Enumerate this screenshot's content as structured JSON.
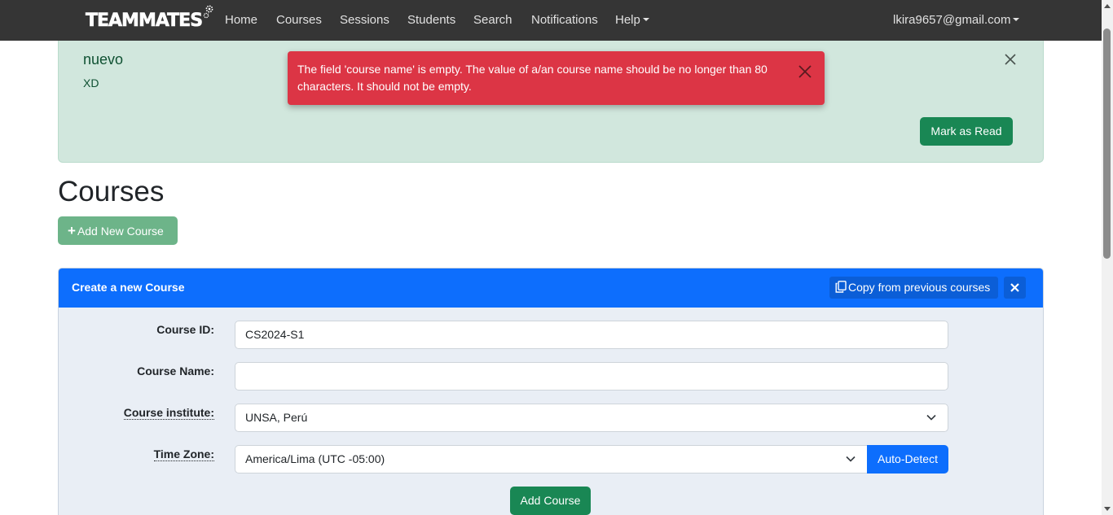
{
  "navbar": {
    "brand": "TEAMMATES",
    "items": [
      "Home",
      "Courses",
      "Sessions",
      "Students",
      "Search",
      "Notifications",
      "Help"
    ],
    "user": "lkira9657@gmail.com"
  },
  "notification": {
    "title": "nuevo",
    "body": "XD",
    "mark_read_label": "Mark as Read"
  },
  "error_toast": {
    "message": "The field 'course name' is empty. The value of a/an course name should be no longer than 80 characters. It should not be empty."
  },
  "page": {
    "title": "Courses",
    "add_new_course_label": "Add New Course"
  },
  "create_course": {
    "title": "Create a new Course",
    "copy_label": "Copy from previous courses",
    "fields": {
      "course_id_label": "Course ID:",
      "course_id_value": "CS2024-S1",
      "course_name_label": "Course Name:",
      "course_name_value": "",
      "institute_label": "Course institute:",
      "institute_value": "UNSA, Perú",
      "timezone_label": "Time Zone:",
      "timezone_value": "America/Lima (UTC -05:00)"
    },
    "auto_detect_label": "Auto-Detect",
    "add_course_label": "Add Course"
  },
  "colors": {
    "navbar": "#353535",
    "primary": "#0d6efd",
    "success": "#198754",
    "danger": "#dc3545",
    "notification_bg": "#d1e7dd"
  }
}
